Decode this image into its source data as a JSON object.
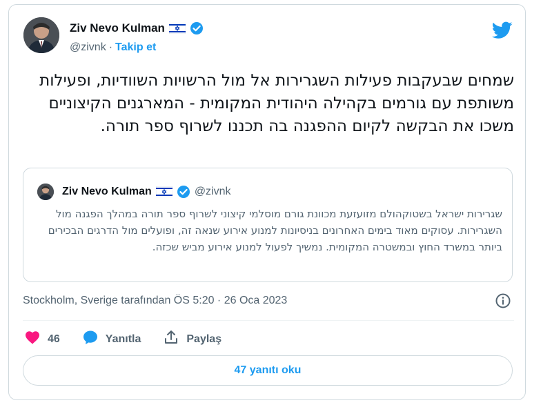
{
  "author": {
    "name": "Ziv Nevo Kulman",
    "handle": "@zivnk",
    "separator": "·",
    "follow_label": "Takip et"
  },
  "tweet": {
    "text": "שמחים שבעקבות פעילות השגרירות אל מול הרשויות השוודיות, ופעילות משותפת עם גורמים בקהילה היהודית המקומית - המארגנים הקיצוניים משכו את הבקשה לקיום ההפגנה בה תכננו לשרוף ספר תורה."
  },
  "quoted_tweet": {
    "name": "Ziv Nevo Kulman",
    "handle": "@zivnk",
    "text": "שגרירות ישראל בשטוקהולם מזועזעת מכוונת גורם מוסלמי קיצוני לשרוף ספר תורה במהלך הפגנה מול השגרירות. עסוקים מאוד בימים האחרונים בניסיונות למנוע אירוע שנאה זה, ופועלים מול הדרגים הבכירים ביותר במשרד החוץ ובמשטרה המקומית. נמשיך לפעול למנוע אירוע מביש שכזה."
  },
  "meta": {
    "location_time": "Stockholm, Sverige tarafından ÖS 5:20 · 26 Oca 2023"
  },
  "actions": {
    "likes_count": "46",
    "reply_label": "Yanıtla",
    "share_label": "Paylaş"
  },
  "replies_button": "47 yanıtı oku",
  "colors": {
    "accent": "#1d9bf0",
    "like": "#f91880",
    "muted": "#536471",
    "border": "#cfd9de"
  },
  "icons": [
    "israel-flag-icon",
    "verified-badge-icon",
    "twitter-bird-icon",
    "info-icon",
    "heart-icon",
    "reply-bubble-icon",
    "share-icon"
  ]
}
